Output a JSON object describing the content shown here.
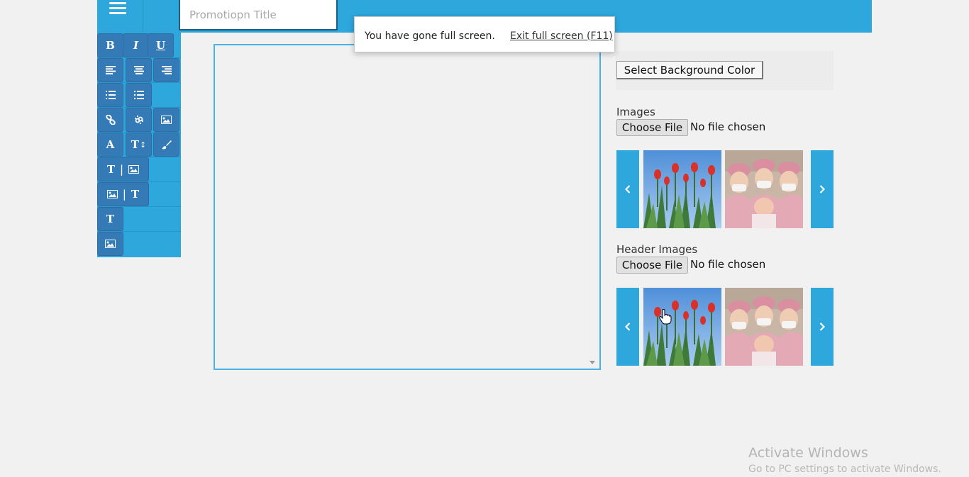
{
  "header": {
    "title_placeholder": "Promotiopn Title",
    "menu_icon": "hamburger-menu-icon",
    "accent_color": "#2ea7dd"
  },
  "toolbar": {
    "bold": "B",
    "italic": "I",
    "underline": "U",
    "font_color": "A",
    "text_size": "T",
    "text_only": "T",
    "separator": "|",
    "button_color": "#337ab7"
  },
  "fullscreen_notice": {
    "message": "You have gone full screen.",
    "exit_label": "Exit full screen (F11)"
  },
  "sidebar": {
    "bg_color_button": "Select Background Color",
    "images": {
      "label": "Images",
      "choose_file": "Choose File",
      "status": "No file chosen",
      "thumbnails": [
        "tulips",
        "nurses-with-baby"
      ]
    },
    "header_images": {
      "label": "Header Images",
      "choose_file": "Choose File",
      "status": "No file chosen",
      "thumbnails": [
        "tulips",
        "nurses-with-baby"
      ]
    }
  },
  "os_watermark": {
    "title": "Activate Windows",
    "subtitle": "Go to PC settings to activate Windows."
  }
}
